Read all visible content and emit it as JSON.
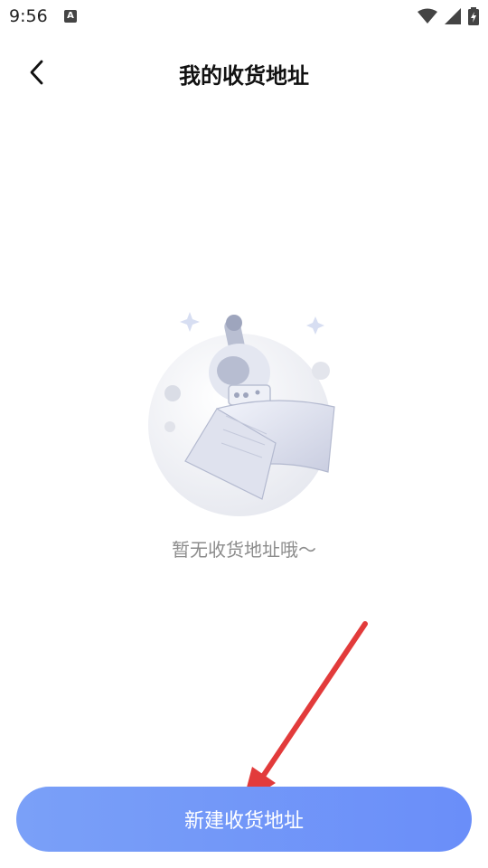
{
  "status_bar": {
    "time": "9:56",
    "left_icon": "a-icon",
    "icons": [
      "wifi-icon",
      "signal-icon",
      "battery-icon"
    ]
  },
  "header": {
    "title": "我的收货地址",
    "back_icon": "back-chevron-icon"
  },
  "empty_state": {
    "illustration": "astronaut-moon-empty-illustration",
    "message": "暂无收货地址哦～"
  },
  "footer": {
    "new_address_label": "新建收货地址"
  },
  "colors": {
    "button_gradient_start": "#7aa0f8",
    "button_gradient_end": "#6a8ef9",
    "arrow": "#e23b3b"
  }
}
